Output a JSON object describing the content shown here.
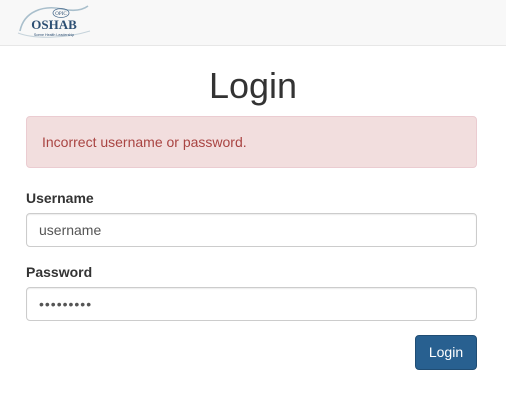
{
  "header": {
    "logo": {
      "text": "OSHAB",
      "badge": "OPIC",
      "tagline": "Scene Health Leadership"
    }
  },
  "main": {
    "title": "Login",
    "alert": {
      "message": "Incorrect username or password."
    },
    "username": {
      "label": "Username",
      "value": "username"
    },
    "password": {
      "label": "Password",
      "value": "•••••••••"
    },
    "submit_label": "Login"
  },
  "colors": {
    "navbar_bg": "#f8f8f8",
    "alert_bg": "#f2dede",
    "alert_text": "#a94442",
    "button_bg": "#286090"
  }
}
